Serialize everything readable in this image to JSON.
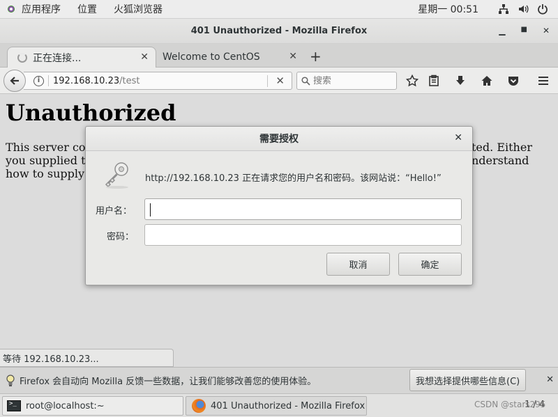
{
  "topbar": {
    "applications": "应用程序",
    "places": "位置",
    "firefox_app": "火狐浏览器",
    "clock": "星期一 00:51"
  },
  "window": {
    "title": "401 Unauthorized - Mozilla Firefox"
  },
  "tabs": [
    {
      "label": "正在连接..."
    },
    {
      "label": "Welcome to CentOS"
    }
  ],
  "navbar": {
    "url_host": "192.168.10.23",
    "url_path": "/test",
    "search_placeholder": "搜索"
  },
  "page": {
    "heading": "Unauthorized",
    "line1": "This server co",
    "line1_right": "ted. Either",
    "line2": "you supplied th",
    "line2_right": "nderstand",
    "line3": "how to supply"
  },
  "dialog": {
    "title": "需要授权",
    "message": "http://192.168.10.23 正在请求您的用户名和密码。该网站说：“Hello!”",
    "username_label": "用户名：",
    "password_label": "密码：",
    "username_value": "",
    "password_value": "",
    "cancel_label": "取消",
    "ok_label": "确定"
  },
  "status": {
    "text": "等待 192.168.10.23..."
  },
  "notification": {
    "text": "Firefox 会自动向 Mozilla 反馈一些数据，让我们能够改善您的使用体验。",
    "button": "我想选择提供哪些信息(C)"
  },
  "taskbar": {
    "items": [
      {
        "label": "root@localhost:~"
      },
      {
        "label": "401 Unauthorized - Mozilla Firefox"
      }
    ],
    "workspace": "1 / 4"
  },
  "watermark": "CSDN @stars295"
}
